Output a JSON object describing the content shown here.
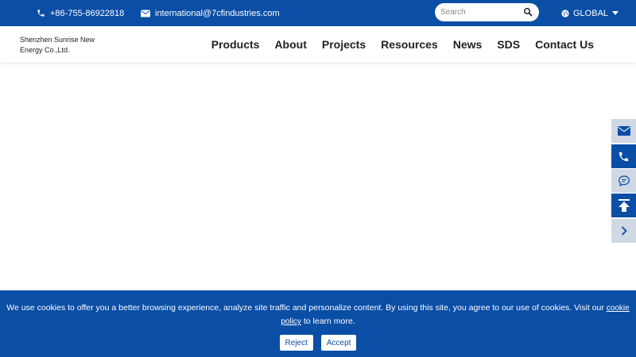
{
  "topbar": {
    "phone": "+86-755-86922818",
    "email": "international@7cfindustries.com",
    "search_placeholder": "Search",
    "region": "GLOBAL"
  },
  "header": {
    "logo_line1": "Shenzhen Sunrise New",
    "logo_line2": "Energy Co.,Ltd.",
    "nav": [
      "Products",
      "About",
      "Projects",
      "Resources",
      "News",
      "SDS",
      "Contact Us"
    ]
  },
  "sidebar": {
    "icons": [
      "mail-icon",
      "phone-icon",
      "chat-icon",
      "back-to-top-icon",
      "chevron-right-icon"
    ]
  },
  "cookie": {
    "message": "We use cookies to offer you a better browsing experience, analyze site traffic and personalize content. By using this site, you agree to our use of cookies. Visit our",
    "link": "cookie policy",
    "message_end": "to learn more.",
    "reject": "Reject",
    "accept": "Accept"
  },
  "colors": {
    "brand_blue": "#0a4ea6",
    "side_light": "#cfd8e3"
  }
}
